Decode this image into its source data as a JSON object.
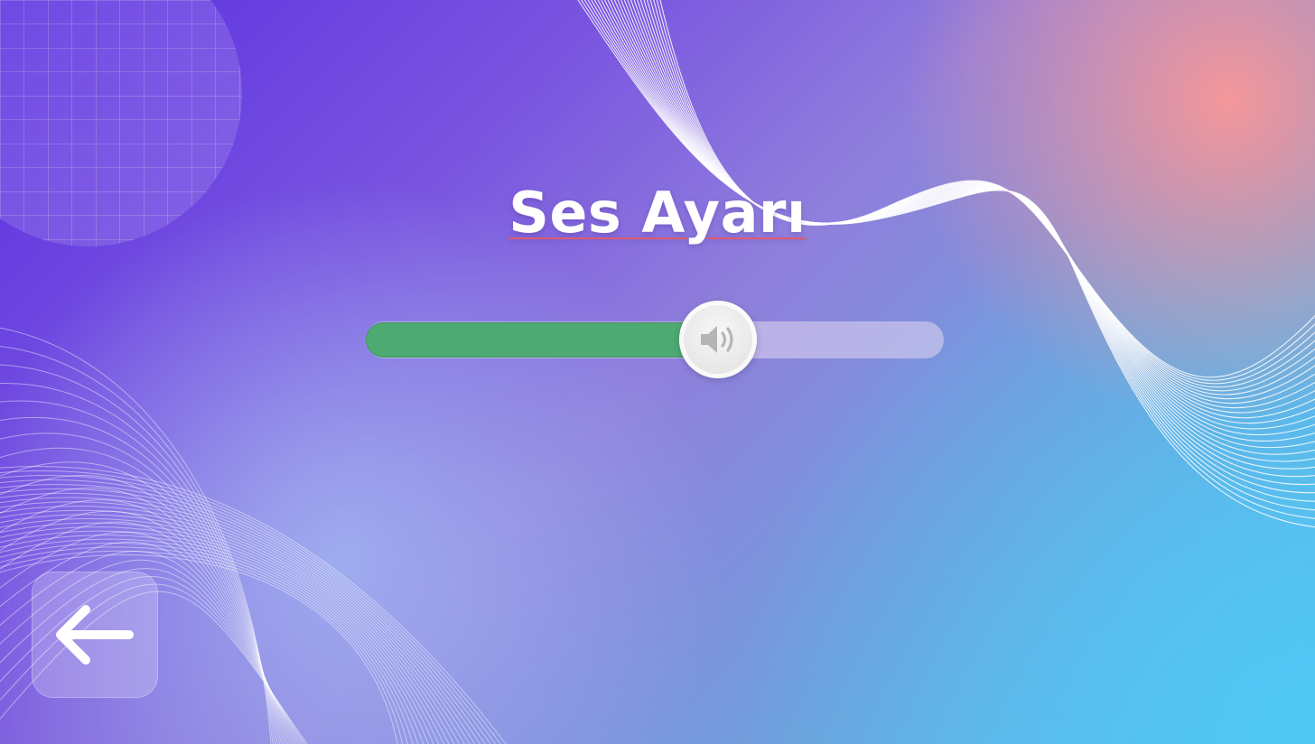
{
  "screen": {
    "title": "Ses Ayarı"
  },
  "volume": {
    "level": 0.61,
    "fill_color": "#4caa72",
    "thumb_icon": "speaker-volume-icon"
  },
  "navigation": {
    "back_icon": "arrow-left-icon"
  },
  "colors": {
    "background_top_left": "#5b2fe0",
    "background_top_right": "#f49aa0",
    "background_bottom_right": "#55c4f0",
    "title_text": "#ffffff"
  }
}
